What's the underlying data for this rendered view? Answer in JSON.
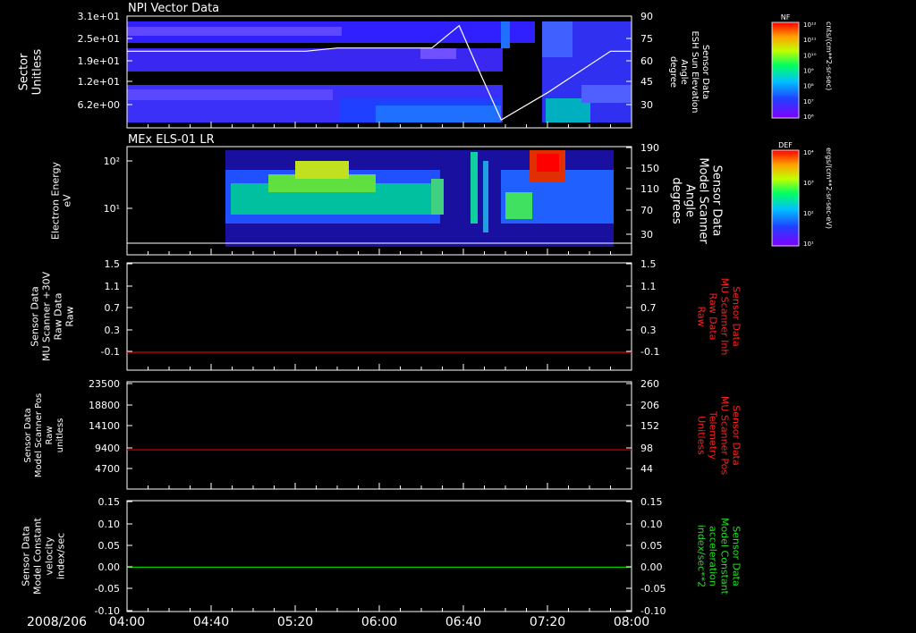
{
  "time_axis": {
    "date": "2008/206",
    "ticks": [
      "04:00",
      "04:40",
      "05:20",
      "06:00",
      "06:40",
      "07:20",
      "08:00"
    ]
  },
  "panels": [
    {
      "id": "npi",
      "title": "NPI Vector Data",
      "left_label": [
        "Sector",
        "Unitless"
      ],
      "left_ticks": [
        "3.1e+01",
        "2.5e+01",
        "1.9e+01",
        "1.2e+01",
        "6.2e+00"
      ],
      "right_label": [
        "Sensor Data",
        "ESH Sun Elevation",
        "Angle",
        "degree"
      ],
      "right_ticks": [
        "90",
        "75",
        "60",
        "45",
        "30"
      ],
      "colorbar": {
        "title": "NF",
        "unit": "cnts/(cm**2-sr-sec)",
        "ticks": [
          "10¹²",
          "10¹¹",
          "10¹⁰",
          "10⁹",
          "10⁸",
          "10⁷",
          "10⁶"
        ]
      }
    },
    {
      "id": "els",
      "title": "MEx ELS-01 LR",
      "left_label": [
        "Electron Energy",
        "eV"
      ],
      "left_ticks": [
        "10²",
        "10¹"
      ],
      "right_label": [
        "Sensor Data",
        "Model Scanner",
        "Angle",
        "degrees"
      ],
      "right_ticks": [
        "190",
        "150",
        "110",
        "70",
        "30"
      ],
      "colorbar": {
        "title": "DEF",
        "unit": "ergs/(cm**2-sr-sec-eV)",
        "ticks": [
          "10⁴",
          "10³",
          "10²",
          "10¹"
        ]
      }
    },
    {
      "id": "mu_raw",
      "left_label": [
        "Sensor Data",
        "MU Scanner +30V",
        "Raw Data",
        "Raw"
      ],
      "left_ticks": [
        "1.5",
        "1.1",
        "0.7",
        "0.3",
        "-0.1"
      ],
      "right_label": [
        "Sensor Data",
        "MU Scanner Inh",
        "Raw Data",
        "Raw"
      ],
      "right_ticks": [
        "1.5",
        "1.1",
        "0.7",
        "0.3",
        "-0.1"
      ]
    },
    {
      "id": "scanner_pos",
      "left_label": [
        "Sensor Data",
        "Model Scanner Pos",
        "Raw",
        "unitless"
      ],
      "left_ticks": [
        "23500",
        "18800",
        "14100",
        "9400",
        "4700"
      ],
      "right_label": [
        "Sensor Data",
        "MU Scanner Pos",
        "Telemetry",
        "Unitless"
      ],
      "right_ticks": [
        "260",
        "206",
        "152",
        "98",
        "44"
      ]
    },
    {
      "id": "constant",
      "left_label": [
        "Sensor Data",
        "Model Constant",
        "velocity",
        "index/sec"
      ],
      "left_ticks": [
        "0.15",
        "0.10",
        "0.05",
        "0.00",
        "-0.05",
        "-0.10"
      ],
      "right_label": [
        "Sensor Data",
        "Model Constant",
        "acceleration",
        "index/sec**2"
      ],
      "right_ticks": [
        "0.15",
        "0.10",
        "0.05",
        "0.00",
        "-0.05",
        "-0.10"
      ]
    }
  ],
  "colors": {
    "red_trace": "#e00000",
    "green_trace": "#00d000",
    "red_label": "#ff2020",
    "green_label": "#20e020"
  },
  "chart_data": [
    {
      "type": "heatmap",
      "title": "NPI Vector Data",
      "ylabel": "Sector Unitless",
      "y2label": "Sensor Data ESH Sun Elevation Angle degree",
      "xlim": [
        "04:00",
        "08:00"
      ],
      "y2lim": [
        20,
        90
      ],
      "overlay_line": {
        "name": "ESH Sun Elevation Angle",
        "x": [
          "04:00",
          "05:25",
          "05:40",
          "06:25",
          "06:38",
          "06:46",
          "06:58",
          "07:20",
          "07:50",
          "08:00"
        ],
        "y": [
          68,
          68,
          70,
          70,
          84,
          60,
          25,
          42,
          68,
          68
        ]
      }
    },
    {
      "type": "heatmap",
      "title": "MEx ELS-01 LR",
      "ylabel": "Electron Energy eV",
      "yscale": "log",
      "y2label": "Sensor Data Model Scanner Angle degrees",
      "y2lim": [
        10,
        190
      ],
      "xlim": [
        "04:00",
        "08:00"
      ]
    },
    {
      "type": "line",
      "ylabel": "Sensor Data MU Scanner +30V Raw Data Raw",
      "y2label": "Sensor Data MU Scanner Inh Raw Data Raw",
      "ylim": [
        -0.3,
        1.5
      ],
      "series": [
        {
          "x": [
            "04:00",
            "08:00"
          ],
          "y": [
            0,
            0
          ]
        }
      ]
    },
    {
      "type": "line",
      "ylabel": "Sensor Data Model Scanner Pos Raw unitless",
      "y2label": "Sensor Data MU Scanner Pos Telemetry Unitless",
      "ylim": [
        0,
        23500
      ],
      "series": [
        {
          "x": [
            "04:00",
            "08:00"
          ],
          "y": [
            8600,
            8600
          ]
        }
      ]
    },
    {
      "type": "line",
      "ylabel": "Sensor Data Model Constant velocity index/sec",
      "y2label": "Sensor Data Model Constant acceleration index/sec**2",
      "ylim": [
        -0.1,
        0.15
      ],
      "series": [
        {
          "x": [
            "04:00",
            "08:00"
          ],
          "y": [
            0.0,
            0.0
          ]
        }
      ]
    }
  ]
}
